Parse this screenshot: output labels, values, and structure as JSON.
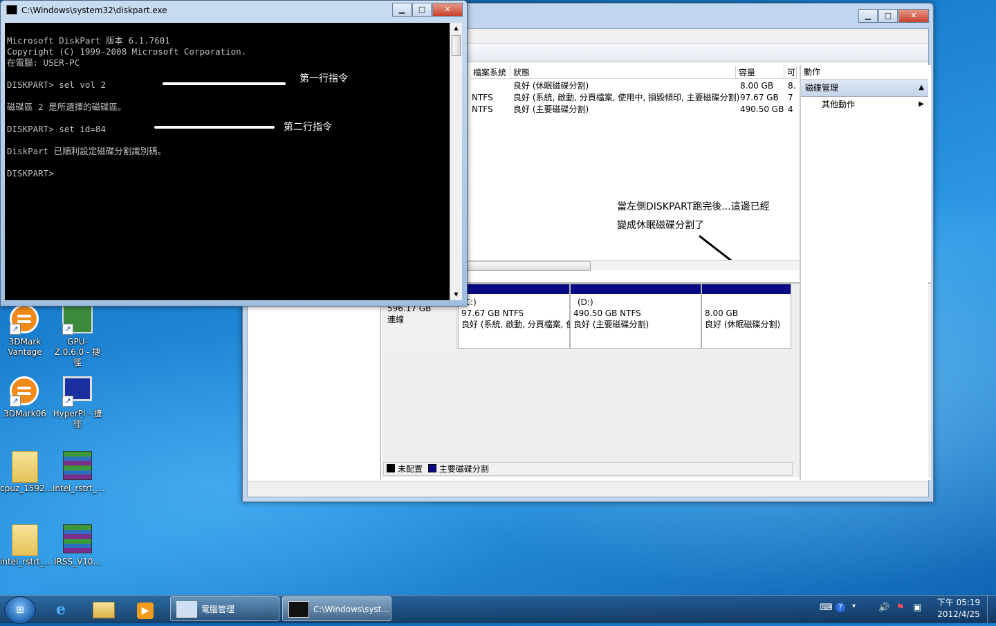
{
  "desktop": {
    "icons": [
      {
        "label": "3DMark Vantage"
      },
      {
        "label": "GPU-Z.0.6.0 - 捷徑"
      },
      {
        "label": "3DMark06"
      },
      {
        "label": "HyperPI - 捷徑"
      },
      {
        "label": "cpuz_1592..."
      },
      {
        "label": "intel_rstrt_..."
      },
      {
        "label": "intel_rstrt_..."
      },
      {
        "label": "IRSS_V10..."
      }
    ]
  },
  "mgmt": {
    "columns": [
      "檔案系統",
      "狀態",
      "容量",
      "可"
    ],
    "volumes": [
      {
        "fs": "",
        "status": "良好 (休眠磁碟分割)",
        "capacity": "8.00 GB",
        "free": "8."
      },
      {
        "fs": "NTFS",
        "status": "良好 (系統, 啟動, 分頁檔案, 使用中, 損毀傾印, 主要磁碟分割)",
        "capacity": "97.67 GB",
        "free": "7"
      },
      {
        "fs": "NTFS",
        "status": "良好 (主要磁碟分割)",
        "capacity": "490.50 GB",
        "free": "4"
      }
    ],
    "annotation": [
      "當左側DISKPART跑完後...這邊已經",
      "變成休眠磁碟分割了"
    ],
    "disk": {
      "size": "596.17 GB",
      "state": "連線"
    },
    "partitions": [
      {
        "name": "(C:)",
        "size": "97.67 GB NTFS",
        "status": "良好 (系統, 啟動, 分頁檔案, 使"
      },
      {
        "name": "(D:)",
        "size": "490.50 GB NTFS",
        "status": "良好 (主要磁碟分割)"
      },
      {
        "name": "",
        "size": "8.00 GB",
        "status": "良好 (休眠磁碟分割)"
      }
    ],
    "legend": {
      "unallocated": "未配置",
      "primary": "主要磁碟分割"
    },
    "actions": {
      "header": "動作",
      "selected": "磁碟管理",
      "other": "其他動作"
    }
  },
  "cmd": {
    "title": "C:\\Windows\\system32\\diskpart.exe",
    "lines": [
      "Microsoft DiskPart 版本 6.1.7601",
      "Copyright (C) 1999-2008 Microsoft Corporation.",
      "在電腦: USER-PC",
      "",
      "DISKPART> sel vol 2",
      "",
      "磁碟區 2 是所選擇的磁碟區。",
      "",
      "DISKPART> set id=84",
      "",
      "DiskPart 已順利設定磁碟分割識別碼。",
      "",
      "DISKPART>"
    ],
    "annot1": "第一行指令",
    "annot2": "第二行指令"
  },
  "taskbar": {
    "buttons": [
      "電腦管理",
      "C:\\Windows\\syst..."
    ],
    "time": "下午 05:19",
    "date": "2012/4/25"
  }
}
